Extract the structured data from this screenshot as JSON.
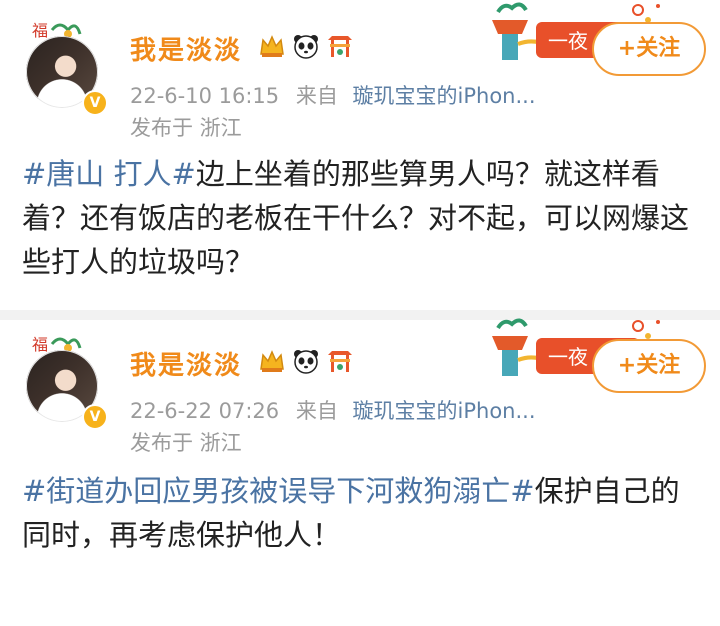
{
  "posts": [
    {
      "username": "我是淡淡",
      "avatar_icon": "user-avatar",
      "vip_badge": "V",
      "badges": [
        "crown-badge-icon",
        "panda-badge-icon",
        "gate-badge-icon"
      ],
      "time": "22-6-10 16:15",
      "from_label": "来自",
      "source": "璇玑宝宝的iPhon...",
      "location": "发布于 浙江",
      "decor_text": "一夜",
      "follow_label": "+关注",
      "hashtag": "#唐山 打人#",
      "body": "边上坐着的那些算男人吗？就这样看着？还有饭店的老板在干什么？对不起，可以网爆这些打人的垃圾吗？"
    },
    {
      "username": "我是淡淡",
      "avatar_icon": "user-avatar",
      "vip_badge": "V",
      "badges": [
        "crown-badge-icon",
        "panda-badge-icon",
        "gate-badge-icon"
      ],
      "time": "22-6-22 07:26",
      "from_label": "来自",
      "source": "璇玑宝宝的iPhon...",
      "location": "发布于 浙江",
      "decor_text": "一夜",
      "follow_label": "+关注",
      "hashtag": "#街道办回应男孩被误导下河救狗溺亡#",
      "body": "保护自己的同时，再考虑保护他人！"
    }
  ],
  "colors": {
    "username": "#f08a1a",
    "hashtag": "#4a73a3",
    "meta": "#9b9b9b",
    "link": "#5d7fa4",
    "follow_border": "#f29a36"
  }
}
